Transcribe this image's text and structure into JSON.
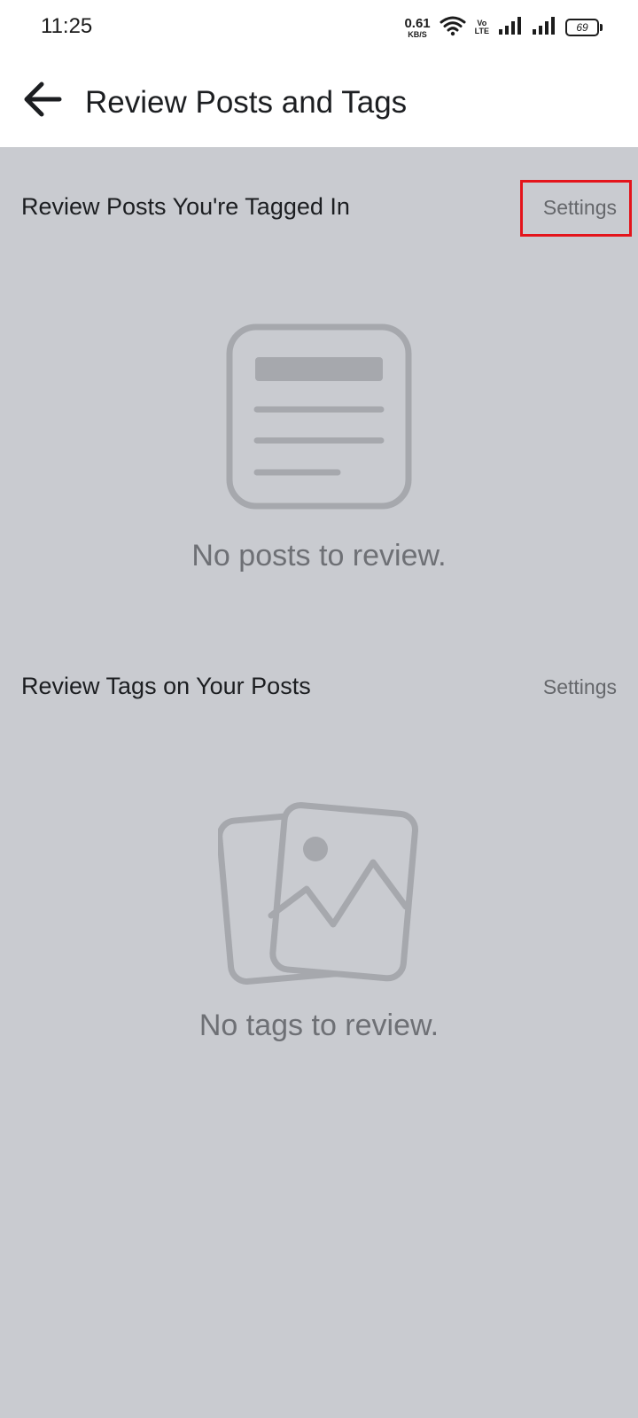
{
  "status_bar": {
    "time": "11:25",
    "net_speed_value": "0.61",
    "net_speed_unit": "KB/S",
    "volte_top": "Vo",
    "volte_bottom": "LTE",
    "battery_level": "69"
  },
  "header": {
    "title": "Review Posts and Tags"
  },
  "sections": [
    {
      "title": "Review Posts You're Tagged In",
      "settings_label": "Settings",
      "empty_message": "No posts to review."
    },
    {
      "title": "Review Tags on Your Posts",
      "settings_label": "Settings",
      "empty_message": "No tags to review."
    }
  ],
  "colors": {
    "background": "#c9cbd0",
    "highlight": "#e4141b",
    "icon_gray": "#a6a8ad"
  },
  "icons": {
    "back": "arrow-left-icon",
    "posts_empty": "document-icon",
    "tags_empty": "photos-icon"
  }
}
